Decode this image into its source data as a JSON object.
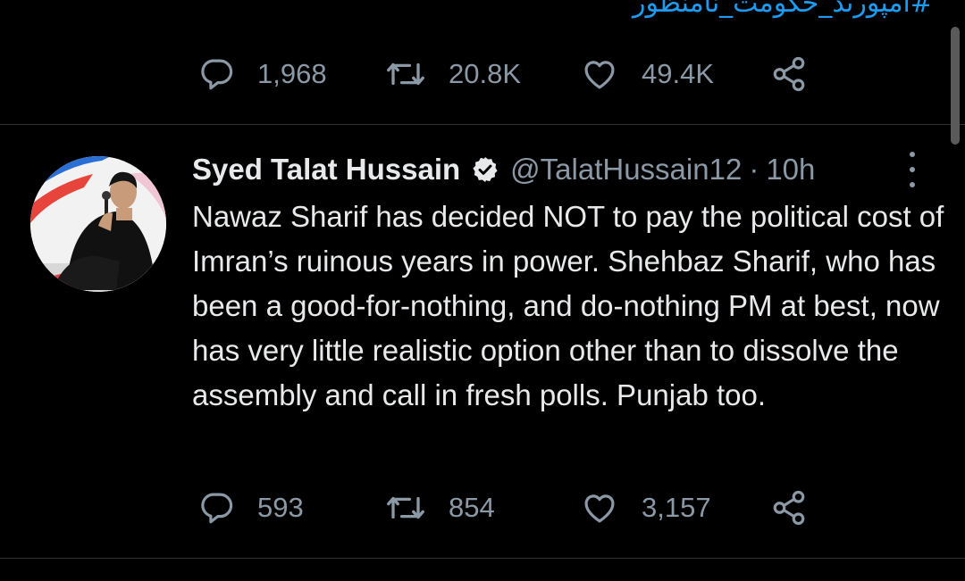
{
  "previous_tweet": {
    "hashtag_partial": "#امپورٹڈ_حکومت_نامنظور",
    "replies": "1,968",
    "retweets": "20.8K",
    "likes": "49.4K"
  },
  "tweet": {
    "display_name": "Syed Talat Hussain",
    "verified": true,
    "handle": "@TalatHussain12",
    "separator": "·",
    "time": "10h",
    "text": "Nawaz Sharif has decided NOT to pay the political cost of Imran’s ruinous years in power. Shehbaz Sharif, who has been a good-for-nothing, and do-nothing PM at best, now has very little realistic option other than to dissolve the assembly and call in fresh polls. Punjab too.",
    "replies": "593",
    "retweets": "854",
    "likes": "3,157"
  },
  "icons": [
    "reply-icon",
    "retweet-icon",
    "like-icon",
    "share-icon",
    "verified-badge-icon",
    "more-options-icon"
  ],
  "colors": {
    "background": "#000000",
    "text": "#e7e9ea",
    "secondary_text": "#8b98a5",
    "link": "#1d9bf0",
    "divider": "#2f3336"
  }
}
